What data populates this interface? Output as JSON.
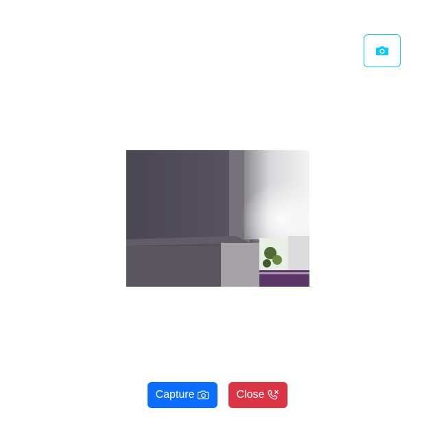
{
  "toolbar": {
    "switch_camera_icon": "camera-icon",
    "accent_color": "#0dcaf0"
  },
  "preview": {
    "content": "live-camera-feed"
  },
  "actions": {
    "capture_label": "Capture",
    "capture_icon": "camera-icon",
    "capture_color": "#0d6efd",
    "close_label": "Close",
    "close_icon": "phone-x-icon",
    "close_color": "#dc3545"
  }
}
